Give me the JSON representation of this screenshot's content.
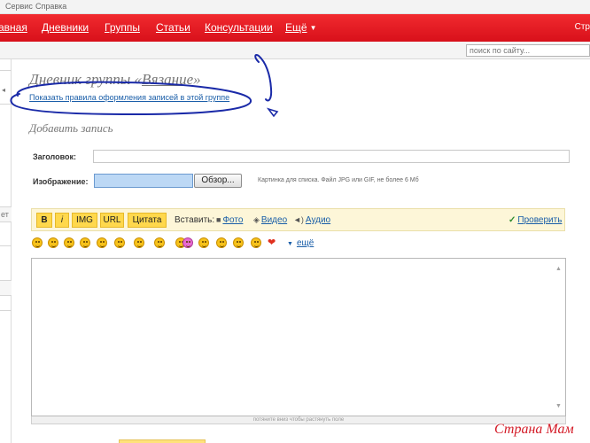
{
  "menubar": {
    "items": [
      "Сервис",
      "Справка"
    ]
  },
  "nav": {
    "items": [
      "авная",
      "Дневники",
      "Группы",
      "Статьи",
      "Консультации",
      "Ещё"
    ],
    "more_arrow": "▼",
    "brand_tab": "Стр"
  },
  "search": {
    "placeholder": "поиск по сайту..."
  },
  "sidebar": {
    "fragment_1": "ет"
  },
  "title": {
    "prefix": "Дневник группы «",
    "group": "Вязание",
    "suffix": "»"
  },
  "rules_link": "Показать правила оформления записей в этой группе",
  "add_heading": "Добавить запись",
  "form": {
    "title_label": "Заголовок:",
    "image_label": "Изображение:",
    "browse_label": "Обзор...",
    "file_hint": "Картинка для списка. Файл JPG или GIF, не более 6 Мб"
  },
  "toolbar": {
    "bold": "B",
    "italic": "i",
    "img": "IMG",
    "url": "URL",
    "quote": "Цитата",
    "insert_label": "Вставить:",
    "photo": "Фото",
    "video": "Видео",
    "audio": "Аудио",
    "check": "Проверить"
  },
  "emoticons": {
    "count": 16,
    "more": "ещё"
  },
  "editor": {
    "resize_hint": "потяните вниз чтобы растянуть поле"
  },
  "watermark": "Страна Мам",
  "colors": {
    "nav_red": "#ec1c24",
    "link_blue": "#1a5ea8",
    "toolbar_bg": "#fdf6d8",
    "button_yellow": "#ffd84c",
    "annotation_blue": "#1a2aa8"
  }
}
